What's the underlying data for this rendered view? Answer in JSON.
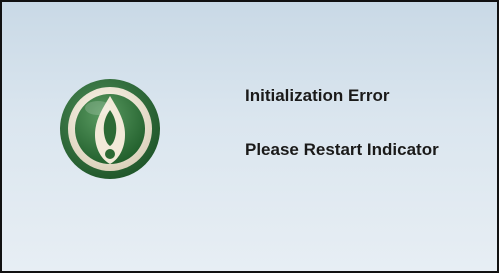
{
  "dialog": {
    "title": "Initialization Error",
    "message": "Please Restart Indicator"
  },
  "icons": {
    "status_icon": "exclamation-drop-icon"
  },
  "colors": {
    "background_top": "#c9d9e6",
    "background_bottom": "#e7eef4",
    "icon_outer_ring": "#2f6f3a",
    "icon_inner_ring": "#e8e1cf",
    "icon_fill": "#2c6a34",
    "text": "#1a1a1a"
  }
}
